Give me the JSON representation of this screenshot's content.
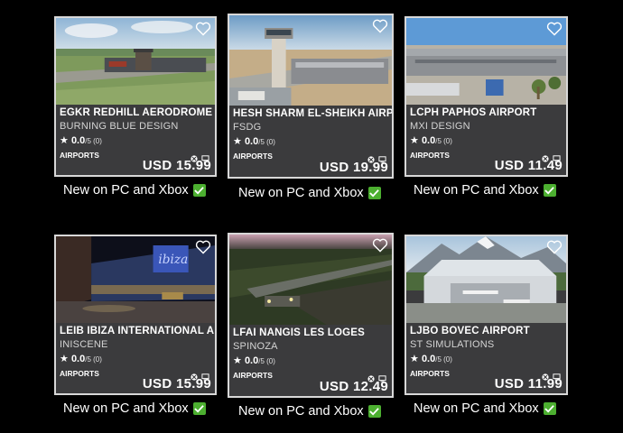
{
  "cards": [
    {
      "title": "EGKR REDHILL AERODROME",
      "developer": "BURNING BLUE DESIGN",
      "rating": "0.0",
      "rating_suffix": "/5 (0)",
      "category": "AIRPORTS",
      "price": "USD 15.99",
      "caption": "New on PC and Xbox"
    },
    {
      "title": "HESH SHARM EL-SHEIKH AIRPORT",
      "developer": "FSDG",
      "rating": "0.0",
      "rating_suffix": "/5 (0)",
      "category": "AIRPORTS",
      "price": "USD 19.99",
      "caption": "New on PC and Xbox"
    },
    {
      "title": "LCPH PAPHOS AIRPORT",
      "developer": "MXI DESIGN",
      "rating": "0.0",
      "rating_suffix": "/5 (0)",
      "category": "AIRPORTS",
      "price": "USD 11.49",
      "caption": "New on PC and Xbox"
    },
    {
      "title": "LEIB IBIZA INTERNATIONAL AIRPORT",
      "developer": "INISCENE",
      "rating": "0.0",
      "rating_suffix": "/5 (0)",
      "category": "AIRPORTS",
      "price": "USD 15.99",
      "caption": "New on PC and Xbox"
    },
    {
      "title": "LFAI NANGIS LES LOGES",
      "developer": "SPINOZA",
      "rating": "0.0",
      "rating_suffix": "/5 (0)",
      "category": "AIRPORTS",
      "price": "USD 12.49",
      "caption": "New on PC and Xbox"
    },
    {
      "title": "LJBO BOVEC AIRPORT",
      "developer": "ST SIMULATIONS",
      "rating": "0.0",
      "rating_suffix": "/5 (0)",
      "category": "AIRPORTS",
      "price": "USD 11.99",
      "caption": "New on PC and Xbox"
    }
  ],
  "icons": {
    "favorite": "heart-icon",
    "xbox": "xbox-icon",
    "pc": "pc-icon",
    "check": "check-icon",
    "star": "star-icon"
  },
  "colors": {
    "background": "#000000",
    "card": "#3b3b3d",
    "check": "#4caf30"
  }
}
